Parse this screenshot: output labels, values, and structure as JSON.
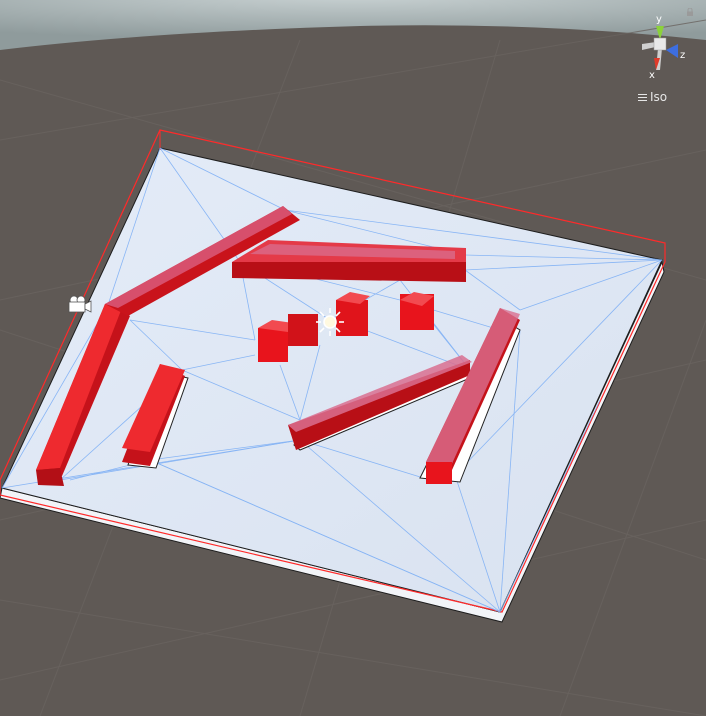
{
  "scene": {
    "projection_label": "Iso",
    "colors": {
      "background": "#5f5955",
      "floor": "#dfe7f4",
      "navmesh_lines": "#6fa2f0",
      "obstacles": "#e8141c",
      "selection_outline": "#ff2020"
    }
  },
  "gizmo": {
    "axis_x": "x",
    "axis_y": "y",
    "axis_z": "z"
  },
  "icons": [
    "camera-icon",
    "directional-light-icon",
    "lock-icon",
    "menu-icon"
  ]
}
